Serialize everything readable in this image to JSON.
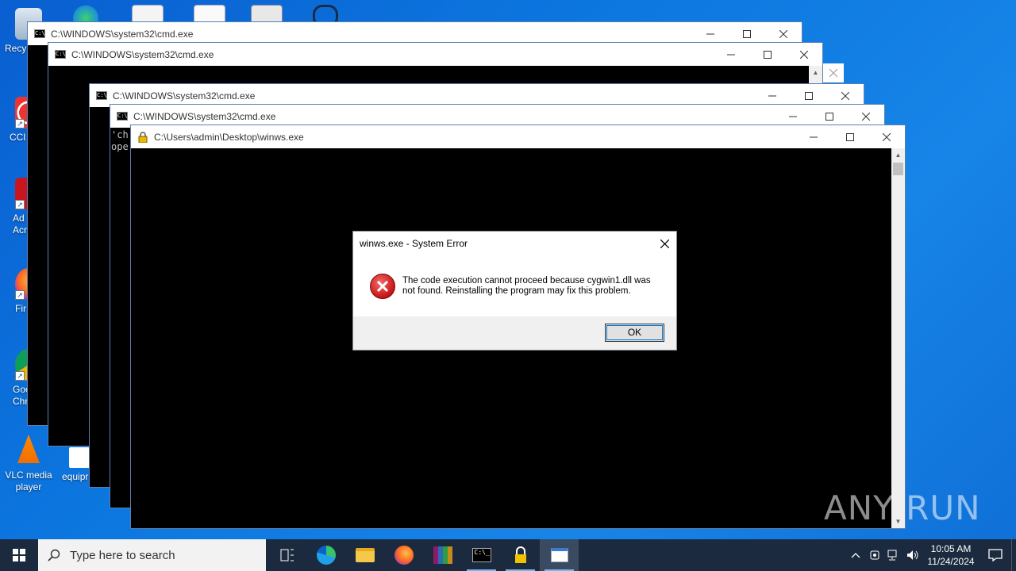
{
  "desktop": {
    "icons": [
      {
        "label": "Recy",
        "name": "recycle-bin"
      },
      {
        "label": "CCl",
        "name": "ccleaner"
      },
      {
        "label": "Ad Acr",
        "name": "adobe-acrobat"
      },
      {
        "label": "Fir",
        "name": "firefox"
      },
      {
        "label": "Goo Chr",
        "name": "google-chrome"
      },
      {
        "label": "VLC media player",
        "name": "vlc-media-player"
      },
      {
        "label": "equipr",
        "name": "equipment-file"
      }
    ]
  },
  "windows": [
    {
      "title": "C:\\WINDOWS\\system32\\cmd.exe"
    },
    {
      "title": "C:\\WINDOWS\\system32\\cmd.exe"
    },
    {
      "title": "C:\\WINDOWS\\system32\\cmd.exe"
    },
    {
      "title": "C:\\WINDOWS\\system32\\cmd.exe",
      "text_line1": "'ch",
      "text_line2": "ope"
    },
    {
      "title": "C:\\Users\\admin\\Desktop\\winws.exe"
    }
  ],
  "dialog": {
    "title": "winws.exe - System Error",
    "message": "The code execution cannot proceed because cygwin1.dll was not found. Reinstalling the program may fix this problem.",
    "ok_label": "OK"
  },
  "taskbar": {
    "search_placeholder": "Type here to search",
    "time": "10:05 AM",
    "date": "11/24/2024"
  },
  "watermark": {
    "text": "ANY RUN"
  },
  "colors": {
    "desktop": "#0c78e0",
    "taskbar": "#1b2a3e",
    "error": "#c81414",
    "accent": "#0078d7"
  }
}
